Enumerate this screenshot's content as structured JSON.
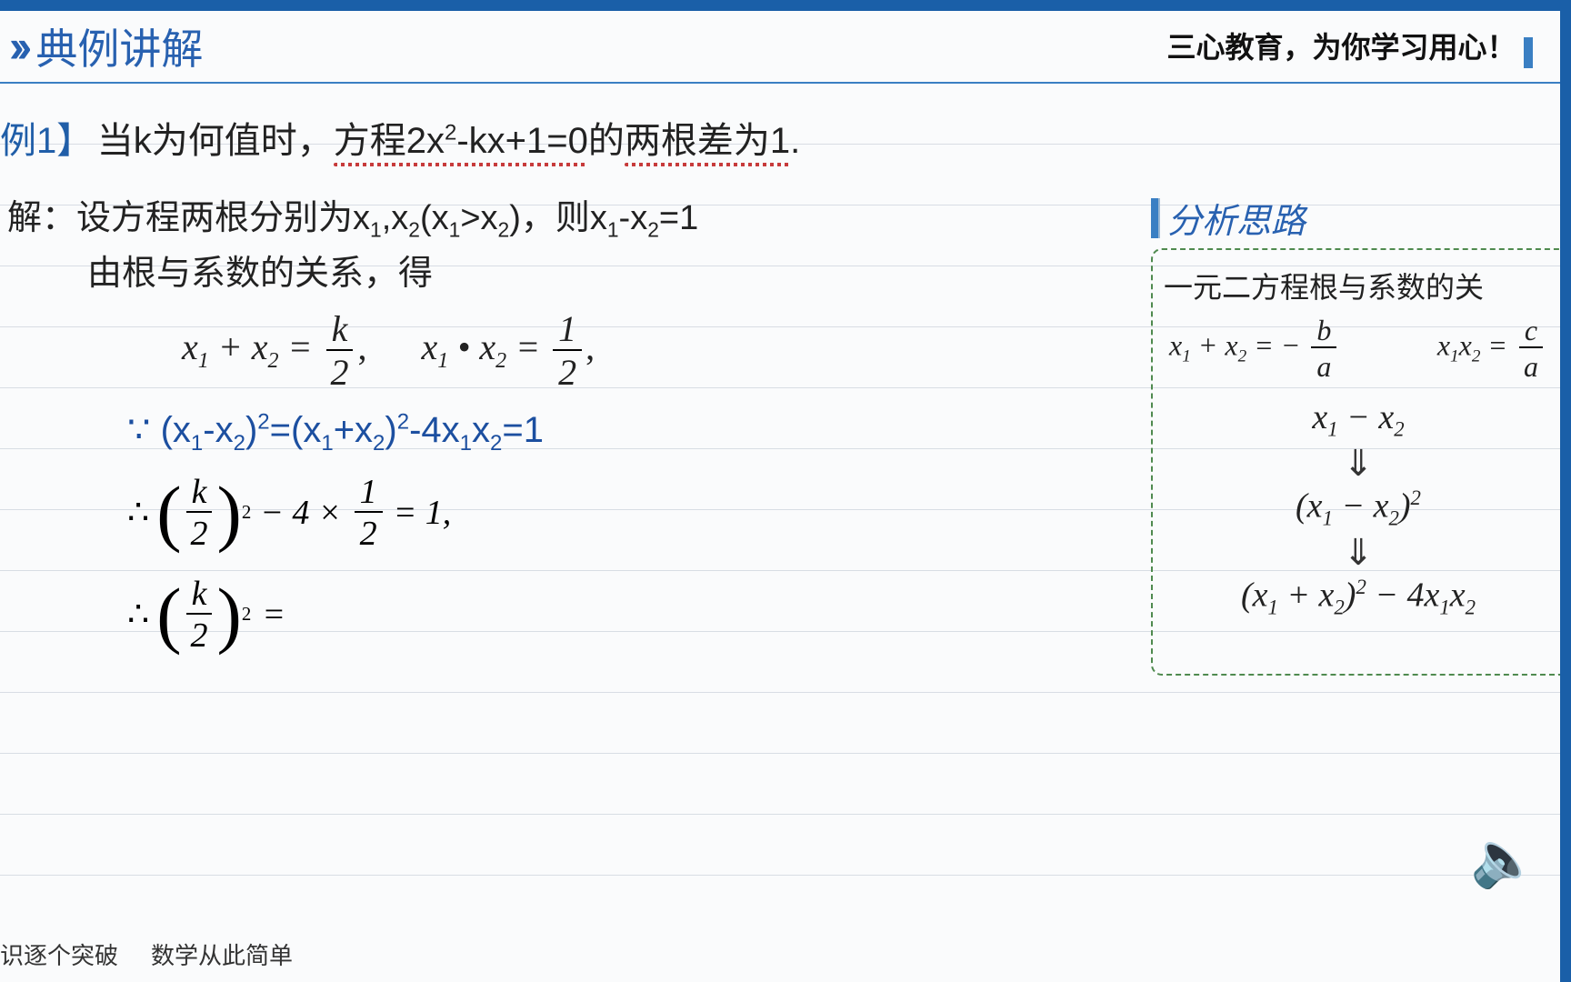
{
  "header": {
    "chevron": "››",
    "section_title": "典例讲解",
    "motto": "三心教育，为你学习用心！"
  },
  "example": {
    "label": "例1】",
    "prompt_pre": "当k为何值时，",
    "prompt_equation_a": "方程2x",
    "prompt_equation_exp": "2",
    "prompt_equation_b": "-kx+1=0",
    "prompt_suffix": "的两根差为1."
  },
  "solution": {
    "line1_label": "解：",
    "line1_a": "设方程两根分别为x",
    "line1_b": ",x",
    "line1_c": "(x",
    "line1_d": ">x",
    "line1_e": ")，则x",
    "line1_f": "-x",
    "line1_g": "=1",
    "line2": "由根与系数的关系，得",
    "sum_eq_left": "x₁ + x₂ =",
    "sum_frac_num": "k",
    "sum_frac_den": "2",
    "prod_eq_left": "x₁ • x₂ =",
    "prod_frac_num": "1",
    "prod_frac_den": "2",
    "because": "∵",
    "because_text": " (x₁-x₂)²=(x₁+x₂)²-4x₁x₂=1",
    "therefore": "∴",
    "k_frac_num": "k",
    "k_frac_den": "2",
    "minus4x": "− 4 ×",
    "half_num": "1",
    "half_den": "2",
    "eq1": "= 1,",
    "eq_blank": "="
  },
  "analysis": {
    "title": "分析思路",
    "desc": "一元二方程根与系数的关",
    "vieta_sum_left": "x₁ + x₂ = −",
    "vieta_sum_num": "b",
    "vieta_sum_den": "a",
    "vieta_prod_left": "x₁x₂ =",
    "vieta_prod_num": "c",
    "vieta_prod_den": "a",
    "flow1": "x₁ − x₂",
    "flow2": "(x₁ − x₂)²",
    "flow3": "(x₁ + x₂)² − 4x₁x₂"
  },
  "footer": {
    "left": "识逐个突破",
    "right": "数学从此简单"
  },
  "icons": {
    "speaker": "🔈"
  }
}
